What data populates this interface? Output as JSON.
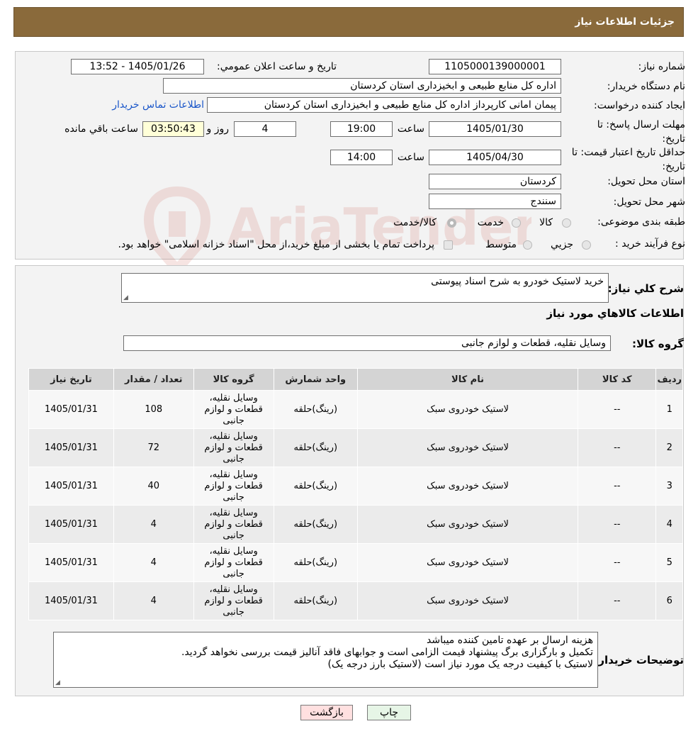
{
  "header": {
    "title": "جزئیات اطلاعات نیاز"
  },
  "form": {
    "need_number_label": "شماره نیاز:",
    "need_number": "1105000139000001",
    "announce_label": "تاریخ و ساعت اعلان عمومي:",
    "announce_value": "1405/01/26 - 13:52",
    "buyer_org_label": "نام دستگاه خريدار:",
    "buyer_org": "اداره کل منابع طبیعی و ابخیزداری استان کردستان",
    "requester_label": "ایجاد کننده درخواست:",
    "requester": "پیمان امانی کارپرداز اداره کل منابع طبیعی و ابخیزداری استان کردستان",
    "contact_link": "اطلاعات تماس خریدار",
    "deadline_label": "مهلت ارسال پاسخ: تا تاريخ:",
    "deadline_date": "1405/01/30",
    "time_label": "ساعت",
    "deadline_time": "19:00",
    "days_value": "4",
    "days_label": "روز و",
    "remaining_time": "03:50:43",
    "remaining_label": "ساعت باقي مانده",
    "validity_label": "حداقل تاريخ اعتبار قيمت: تا تاريخ:",
    "validity_date": "1405/04/30",
    "validity_time": "14:00",
    "province_label": "استان محل تحويل:",
    "province": "کردستان",
    "city_label": "شهر محل تحويل:",
    "city": "سنندج",
    "category_label": "طبقه بندی موضوعی:",
    "category_options": [
      "کالا",
      "خدمت",
      "کالا/خدمت"
    ],
    "process_label": "نوع فرآيند خريد :",
    "process_options": [
      "جزيي",
      "متوسط"
    ],
    "process_note": "پرداخت تمام یا بخشی از مبلغ خرید،از محل \"اسناد خزانه اسلامی\" خواهد بود."
  },
  "summary": {
    "desc_label": "شرح کلي نياز:",
    "desc_value": "خرید لاستیک خودرو به شرح اسناد پیوستی",
    "items_title": "اطلاعات کالاهاي مورد نياز",
    "group_label": "گروه کالا:",
    "group_value": "وسایل نقلیه، قطعات و لوازم جانبی"
  },
  "table": {
    "headers": [
      "رديف",
      "کد کالا",
      "نام کالا",
      "واحد شمارش",
      "گروه کالا",
      "تعداد / مقدار",
      "تاريخ نياز"
    ],
    "rows": [
      {
        "idx": "1",
        "code": "--",
        "name": "لاستیک خودروی سبک",
        "unit": "(رینگ)حلقه",
        "group": "وسایل نقلیه، قطعات و لوازم جانبی",
        "qty": "108",
        "date": "1405/01/31"
      },
      {
        "idx": "2",
        "code": "--",
        "name": "لاستیک خودروی سبک",
        "unit": "(رینگ)حلقه",
        "group": "وسایل نقلیه، قطعات و لوازم جانبی",
        "qty": "72",
        "date": "1405/01/31"
      },
      {
        "idx": "3",
        "code": "--",
        "name": "لاستیک خودروی سبک",
        "unit": "(رینگ)حلقه",
        "group": "وسایل نقلیه، قطعات و لوازم جانبی",
        "qty": "40",
        "date": "1405/01/31"
      },
      {
        "idx": "4",
        "code": "--",
        "name": "لاستیک خودروی سبک",
        "unit": "(رینگ)حلقه",
        "group": "وسایل نقلیه، قطعات و لوازم جانبی",
        "qty": "4",
        "date": "1405/01/31"
      },
      {
        "idx": "5",
        "code": "--",
        "name": "لاستیک خودروی سبک",
        "unit": "(رینگ)حلقه",
        "group": "وسایل نقلیه، قطعات و لوازم جانبی",
        "qty": "4",
        "date": "1405/01/31"
      },
      {
        "idx": "6",
        "code": "--",
        "name": "لاستیک خودروی سبک",
        "unit": "(رینگ)حلقه",
        "group": "وسایل نقلیه، قطعات و لوازم جانبی",
        "qty": "4",
        "date": "1405/01/31"
      }
    ]
  },
  "buyer_notes": {
    "label": "توضیحات خریدار:",
    "lines": [
      "هزینه ارسال بر عهده تامین کننده میباشد",
      "تکمیل و بارگزاری برگ پیشنهاد قیمت الزامی است و جوابهای فاقد آنالیز قیمت بررسی نخواهد گردید.",
      "لاستیک با کیفیت درجه یک مورد نیاز است (لاستیک بارز درجه یک)"
    ]
  },
  "buttons": {
    "print": "چاپ",
    "back": "بازگشت"
  },
  "watermark": {
    "text": "AriaTender.neT"
  },
  "colors": {
    "header_bg": "#8a6a3b",
    "link": "#1a56c9",
    "back_button": "#ffe0e0",
    "print_button": "#e6f5e6",
    "watermark": "#c0392b"
  }
}
